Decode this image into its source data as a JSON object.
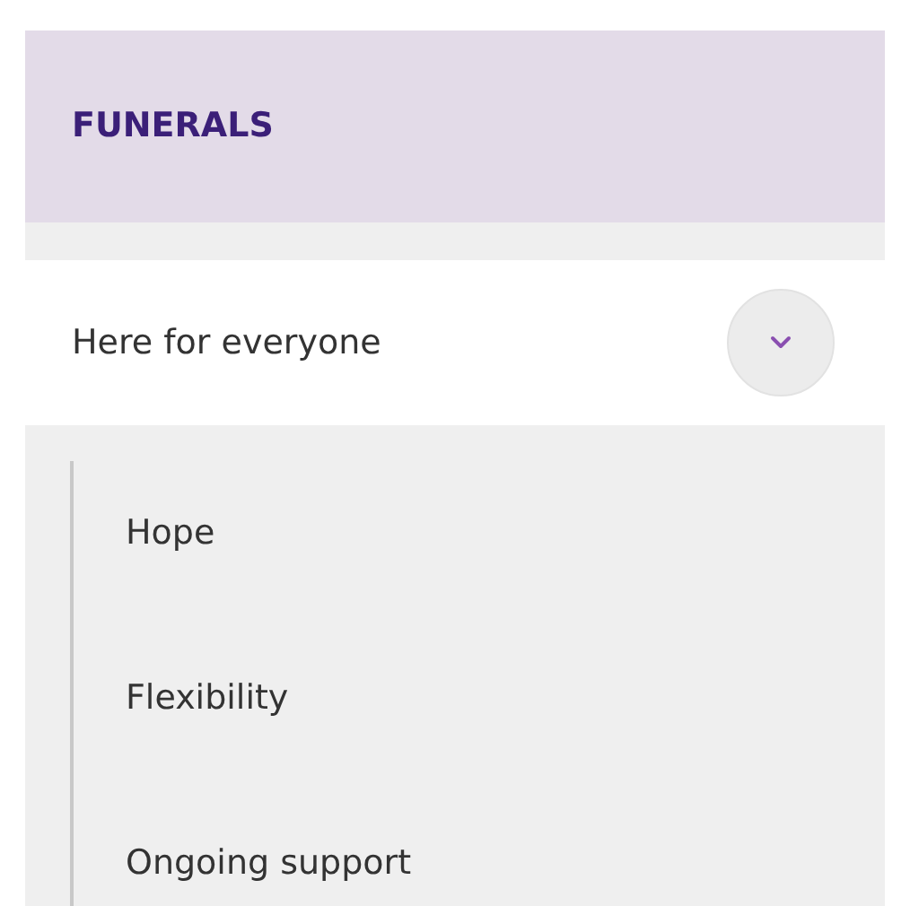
{
  "section": {
    "title": "FUNERALS"
  },
  "menu": {
    "label": "Here for everyone",
    "expanded": true,
    "children": [
      {
        "label": "Hope"
      },
      {
        "label": "Flexibility"
      },
      {
        "label": "Ongoing support"
      }
    ]
  }
}
